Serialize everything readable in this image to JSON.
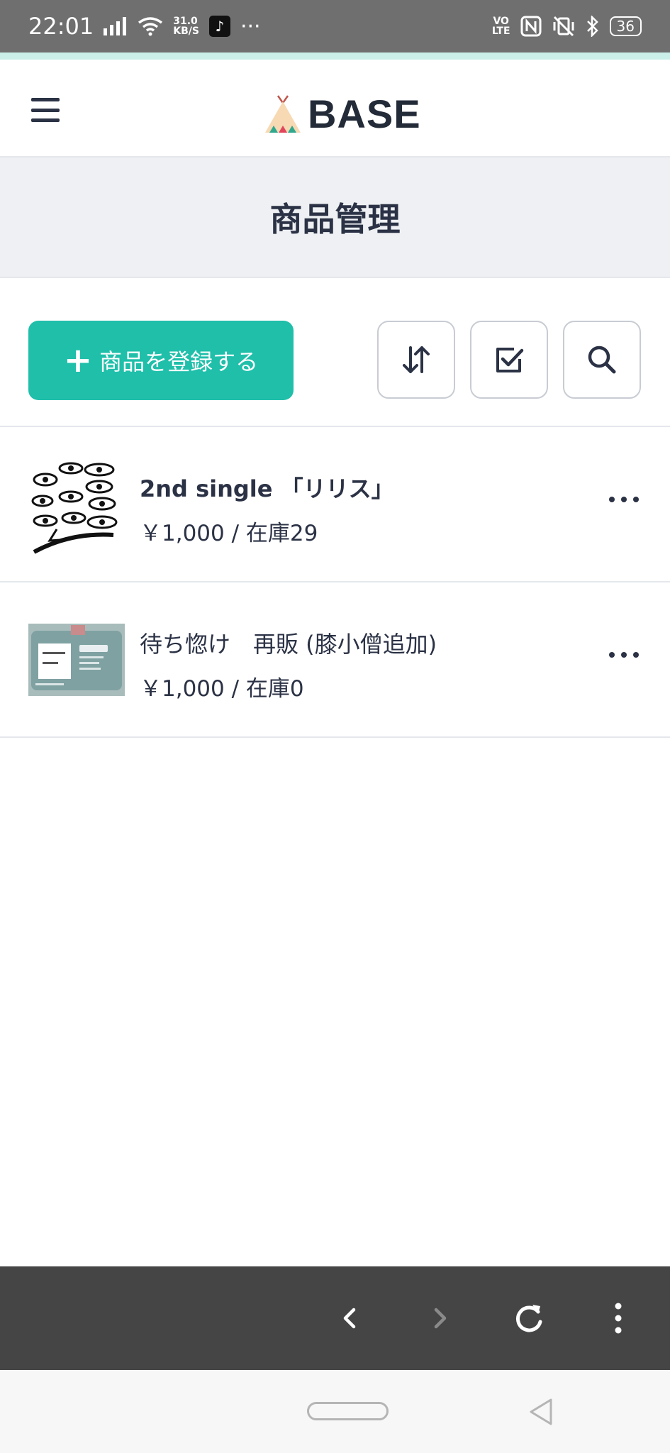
{
  "status_bar": {
    "time": "22:01",
    "net_speed_value": "31.0",
    "net_speed_unit": "KB/S",
    "overflow": "···",
    "volte_top": "VO",
    "volte_bottom": "LTE",
    "battery": "36"
  },
  "header": {
    "logo_text": "BASE",
    "menu_icon": "hamburger-icon"
  },
  "page": {
    "title": "商品管理"
  },
  "toolbar": {
    "add_plus": "+",
    "add_label": "商品を登録する",
    "sort_icon": "sort-arrows-icon",
    "bulk_select_icon": "checkbox-icon",
    "search_icon": "search-icon"
  },
  "products": [
    {
      "name": "2nd single 「リリス」",
      "meta": "￥1,000 / 在庫29"
    },
    {
      "name": "待ち惚け　再販 (膝小僧追加)",
      "meta": "￥1,000 / 在庫0"
    }
  ],
  "browser_bar": {
    "icons": [
      "chevron-left-icon",
      "chevron-right-icon",
      "reload-icon",
      "more-vertical-icon"
    ]
  },
  "colors": {
    "accent": "#1fbfaa",
    "text": "#2b3245",
    "title_bg": "#eef0f3",
    "status_bg": "#6f6f6f",
    "browser_bar_bg": "#454545"
  }
}
